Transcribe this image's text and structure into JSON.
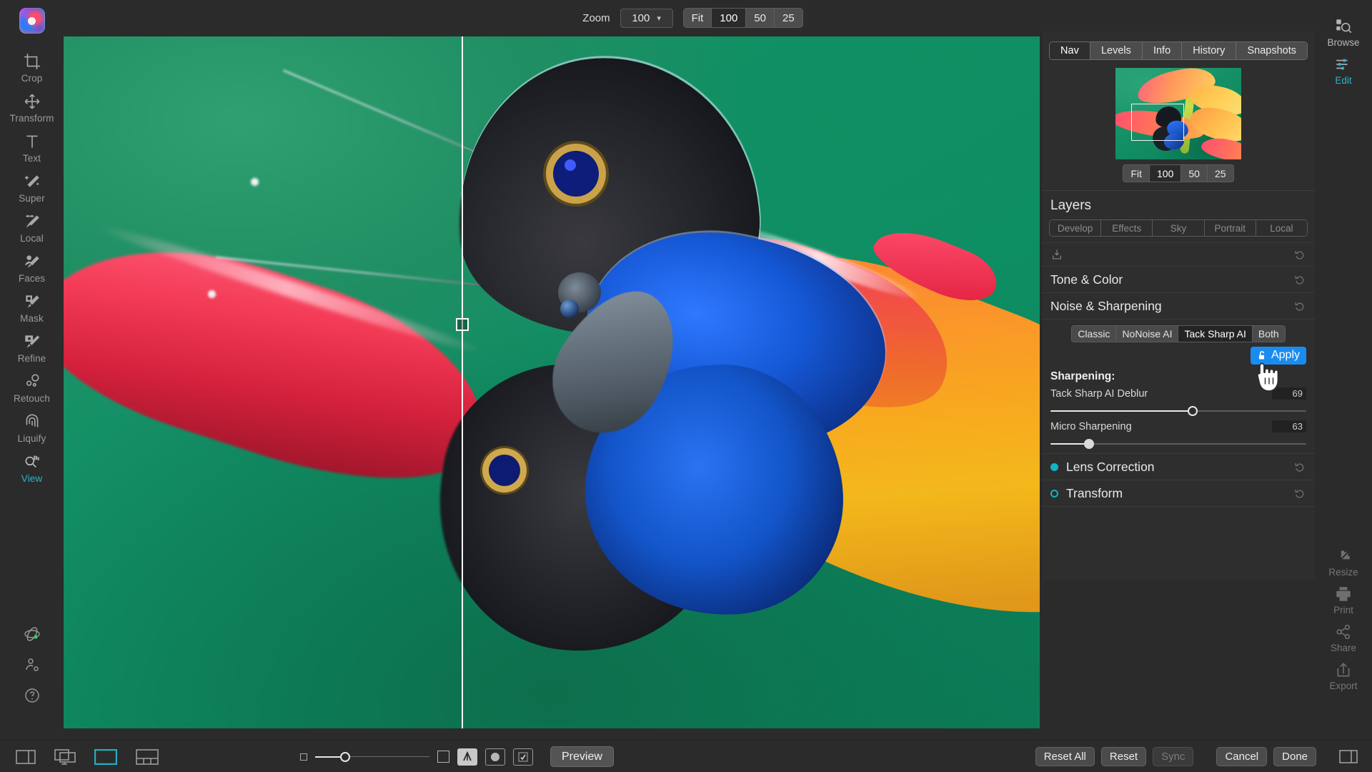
{
  "app": {
    "logo_icon": "app-logo-icon"
  },
  "topbar": {
    "zoom_label": "Zoom",
    "zoom_value": "100",
    "chevron_icon": "chevron-down-icon",
    "presets": [
      {
        "label": "Fit",
        "selected": false
      },
      {
        "label": "100",
        "selected": true
      },
      {
        "label": "50",
        "selected": false
      },
      {
        "label": "25",
        "selected": false
      }
    ]
  },
  "left_rail": {
    "tools": [
      {
        "label": "Crop",
        "icon": "crop-icon",
        "active": false
      },
      {
        "label": "Transform",
        "icon": "transform-icon",
        "active": false
      },
      {
        "label": "Text",
        "icon": "text-icon",
        "active": false
      },
      {
        "label": "Super",
        "icon": "super-wand-icon",
        "active": false
      },
      {
        "label": "Local",
        "icon": "local-brush-icon",
        "active": false
      },
      {
        "label": "Faces",
        "icon": "faces-icon",
        "active": false
      },
      {
        "label": "Mask",
        "icon": "mask-icon",
        "active": false
      },
      {
        "label": "Refine",
        "icon": "refine-icon",
        "active": false
      },
      {
        "label": "Retouch",
        "icon": "retouch-icon",
        "active": false
      },
      {
        "label": "Liquify",
        "icon": "liquify-icon",
        "active": false
      },
      {
        "label": "View",
        "icon": "view-hand-icon",
        "active": true
      }
    ],
    "bottom_icons": [
      {
        "icon": "sync-status-icon"
      },
      {
        "icon": "account-settings-icon"
      },
      {
        "icon": "help-icon"
      }
    ]
  },
  "right_rail": {
    "top_items": [
      {
        "label": "Browse",
        "icon": "browse-icon",
        "active": false
      },
      {
        "label": "Edit",
        "icon": "edit-sliders-icon",
        "active": true
      }
    ],
    "bottom_items": [
      {
        "label": "Resize",
        "icon": "ai-resize-icon",
        "active": false
      },
      {
        "label": "Print",
        "icon": "printer-icon",
        "active": false
      },
      {
        "label": "Share",
        "icon": "share-icon",
        "active": false
      },
      {
        "label": "Export",
        "icon": "export-icon",
        "active": false
      }
    ]
  },
  "right_panel": {
    "tabs": [
      {
        "label": "Nav",
        "selected": true
      },
      {
        "label": "Levels",
        "selected": false
      },
      {
        "label": "Info",
        "selected": false
      },
      {
        "label": "History",
        "selected": false
      },
      {
        "label": "Snapshots",
        "selected": false
      }
    ],
    "nav_presets": [
      {
        "label": "Fit",
        "selected": false
      },
      {
        "label": "100",
        "selected": true
      },
      {
        "label": "50",
        "selected": false
      },
      {
        "label": "25",
        "selected": false
      }
    ],
    "layers": {
      "title": "Layers",
      "tabs": [
        {
          "label": "Develop"
        },
        {
          "label": "Effects"
        },
        {
          "label": "Sky"
        },
        {
          "label": "Portrait"
        },
        {
          "label": "Local"
        }
      ],
      "add_layer_icon": "add-layer-icon",
      "reset_icon": "reset-arrow-icon"
    },
    "sections": [
      {
        "title": "Tone & Color",
        "reset_icon": "reset-arrow-icon"
      }
    ],
    "noise_sharpening": {
      "title": "Noise & Sharpening",
      "reset_icon": "reset-arrow-icon",
      "modes": [
        {
          "label": "Classic",
          "selected": false
        },
        {
          "label": "NoNoise AI",
          "selected": false
        },
        {
          "label": "Tack Sharp AI",
          "selected": true
        },
        {
          "label": "Both",
          "selected": false
        }
      ],
      "apply_button": {
        "label": "Apply",
        "icon": "unlock-icon",
        "color": "#1a8cf0"
      },
      "group_label": "Sharpening:",
      "sliders": [
        {
          "name": "Tack Sharp AI Deblur",
          "value": "69",
          "percent": 69,
          "knob_filled": false
        },
        {
          "name": "Micro Sharpening",
          "value": "63",
          "percent": 17,
          "knob_filled": true
        }
      ]
    },
    "bottom_sections": [
      {
        "title": "Lens Correction",
        "enabled": true,
        "reset_icon": "reset-arrow-icon"
      },
      {
        "title": "Transform",
        "enabled": false,
        "reset_icon": "reset-arrow-icon"
      }
    ],
    "accent_color": "#12b3c6",
    "cursor_icon": "hand-pointer-cursor"
  },
  "bottombar": {
    "left_icons": [
      {
        "icon": "filmstrip-panel-icon",
        "active": false
      },
      {
        "icon": "compare-windows-icon",
        "active": false
      },
      {
        "icon": "single-view-icon",
        "active": true
      },
      {
        "icon": "grid-view-icon",
        "active": false
      }
    ],
    "thumb_slider": {
      "small_square_icon": "small-thumbnail-icon",
      "large_square_icon": "large-thumbnail-icon",
      "percent": 22
    },
    "toggles": [
      {
        "icon": "rating-letter-icon",
        "filled": true
      },
      {
        "icon": "color-label-icon",
        "filled": false
      },
      {
        "icon": "checkmark-badge-icon",
        "filled": false
      }
    ],
    "preview_label": "Preview",
    "right_buttons": [
      {
        "label": "Reset All",
        "disabled": false
      },
      {
        "label": "Reset",
        "disabled": false
      },
      {
        "label": "Sync",
        "disabled": true
      },
      {
        "label": "Cancel",
        "disabled": false
      },
      {
        "label": "Done",
        "disabled": false
      }
    ],
    "right_panel_toggle_icon": "panel-toggle-icon"
  }
}
